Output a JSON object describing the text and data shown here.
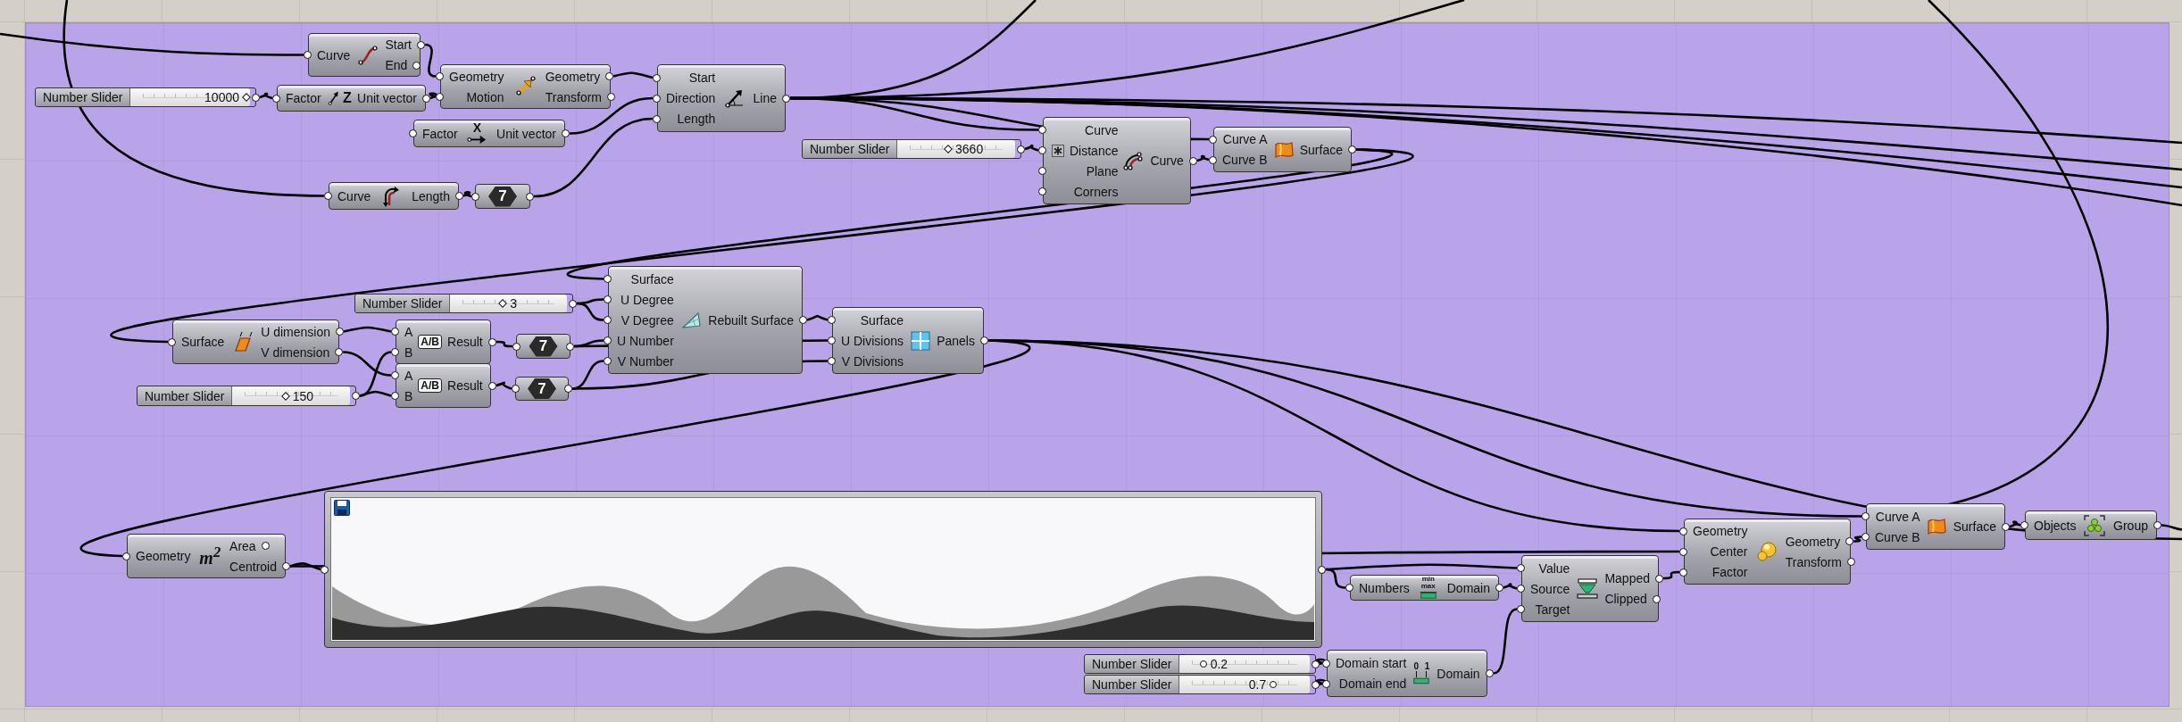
{
  "canvas": {
    "nodes": [
      {
        "kind": "component",
        "inputs": [
          {
            "label": "Curve",
            "flagged": false
          }
        ],
        "outputs": [
          "Start",
          "End"
        ]
      },
      {
        "kind": "slider",
        "label": "Number Slider",
        "value": "10000",
        "level": 0.97,
        "integer": true
      },
      {
        "kind": "component",
        "inputs": [
          {
            "label": "Factor",
            "flagged": false
          }
        ],
        "outputs": [
          "Unit vector"
        ],
        "icon_label": "Z"
      },
      {
        "kind": "component",
        "inputs": [
          {
            "label": "Geometry",
            "flagged": false
          },
          {
            "label": "Motion",
            "flagged": false
          }
        ],
        "outputs": [
          "Geometry",
          "Transform"
        ]
      },
      {
        "kind": "component",
        "inputs": [
          {
            "label": "Factor",
            "flagged": false
          }
        ],
        "outputs": [
          "Unit vector"
        ],
        "icon_label": "X"
      },
      {
        "kind": "component",
        "inputs": [
          {
            "label": "Start",
            "flagged": false
          },
          {
            "label": "Direction",
            "flagged": false
          },
          {
            "label": "Length",
            "flagged": false
          }
        ],
        "outputs": [
          "Line"
        ]
      },
      {
        "kind": "component",
        "inputs": [
          {
            "label": "Curve",
            "flagged": false
          }
        ],
        "outputs": [
          "Length"
        ]
      },
      {
        "kind": "number",
        "value": "7"
      },
      {
        "kind": "slider",
        "label": "Number Slider",
        "value": "3660",
        "level": 0.43,
        "integer": true
      },
      {
        "kind": "component",
        "inputs": [
          {
            "label": "Curve",
            "flagged": false
          },
          {
            "label": "Distance",
            "flagged": true
          },
          {
            "label": "Plane",
            "flagged": false
          },
          {
            "label": "Corners",
            "flagged": false
          }
        ],
        "outputs": [
          "Curve"
        ]
      },
      {
        "kind": "component",
        "inputs": [
          {
            "label": "Curve A",
            "flagged": false
          },
          {
            "label": "Curve B",
            "flagged": false
          }
        ],
        "outputs": [
          "Surface"
        ]
      },
      {
        "kind": "slider",
        "label": "Number Slider",
        "value": "3",
        "level": 0.45,
        "integer": true
      },
      {
        "kind": "component",
        "inputs": [
          {
            "label": "Surface",
            "flagged": false
          },
          {
            "label": "U Degree",
            "flagged": false
          },
          {
            "label": "V Degree",
            "flagged": false
          },
          {
            "label": "U Number",
            "flagged": false
          },
          {
            "label": "V Number",
            "flagged": false
          }
        ],
        "outputs": [
          "Rebuilt Surface"
        ]
      },
      {
        "kind": "component",
        "inputs": [
          {
            "label": "Surface",
            "flagged": false
          }
        ],
        "outputs": [
          "U dimension",
          "V dimension"
        ]
      },
      {
        "kind": "component",
        "inputs": [
          {
            "label": "A",
            "flagged": false
          },
          {
            "label": "B",
            "flagged": false
          }
        ],
        "outputs": [
          "Result"
        ],
        "icon_label": "A/B"
      },
      {
        "kind": "number",
        "value": "7"
      },
      {
        "kind": "component",
        "inputs": [
          {
            "label": "A",
            "flagged": false
          },
          {
            "label": "B",
            "flagged": false
          }
        ],
        "outputs": [
          "Result"
        ],
        "icon_label": "A/B"
      },
      {
        "kind": "number",
        "value": "7"
      },
      {
        "kind": "slider",
        "label": "Number Slider",
        "value": "150",
        "level": 0.45,
        "integer": true
      },
      {
        "kind": "component",
        "inputs": [
          {
            "label": "Surface",
            "flagged": false
          },
          {
            "label": "U Divisions",
            "flagged": false
          },
          {
            "label": "V Divisions",
            "flagged": false
          }
        ],
        "outputs": [
          "Panels"
        ]
      },
      {
        "kind": "component",
        "inputs": [
          {
            "label": "Geometry",
            "flagged": false
          }
        ],
        "outputs": [
          "Area",
          "Centroid"
        ],
        "icon_label": "m$^{2}$"
      },
      {
        "kind": "graph"
      },
      {
        "kind": "component",
        "inputs": [
          {
            "label": "Numbers",
            "flagged": false
          }
        ],
        "outputs": [
          "Domain"
        ],
        "icon_label": "min max"
      },
      {
        "kind": "component",
        "inputs": [
          {
            "label": "Value",
            "flagged": false
          },
          {
            "label": "Source",
            "flagged": false
          },
          {
            "label": "Target",
            "flagged": false
          }
        ],
        "outputs": [
          "Mapped",
          "Clipped"
        ]
      },
      {
        "kind": "component",
        "inputs": [
          {
            "label": "Geometry",
            "flagged": false
          },
          {
            "label": "Center",
            "flagged": false
          },
          {
            "label": "Factor",
            "flagged": false
          }
        ],
        "outputs": [
          "Geometry",
          "Transform"
        ]
      },
      {
        "kind": "component",
        "inputs": [
          {
            "label": "Curve A",
            "flagged": false
          },
          {
            "label": "Curve B",
            "flagged": false
          }
        ],
        "outputs": [
          "Surface"
        ]
      },
      {
        "kind": "component",
        "inputs": [
          {
            "label": "Objects",
            "flagged": false
          }
        ],
        "outputs": [
          "Group"
        ]
      },
      {
        "kind": "slider",
        "label": "Number Slider",
        "value": "0.2",
        "level": 0.18,
        "integer": false
      },
      {
        "kind": "slider",
        "label": "Number Slider",
        "value": "0.7",
        "level": 0.72,
        "integer": false
      },
      {
        "kind": "component",
        "inputs": [
          {
            "label": "Domain start",
            "flagged": false
          },
          {
            "label": "Domain end",
            "flagged": false
          }
        ],
        "outputs": [
          "Domain"
        ],
        "icon_label": "0 1"
      }
    ]
  }
}
